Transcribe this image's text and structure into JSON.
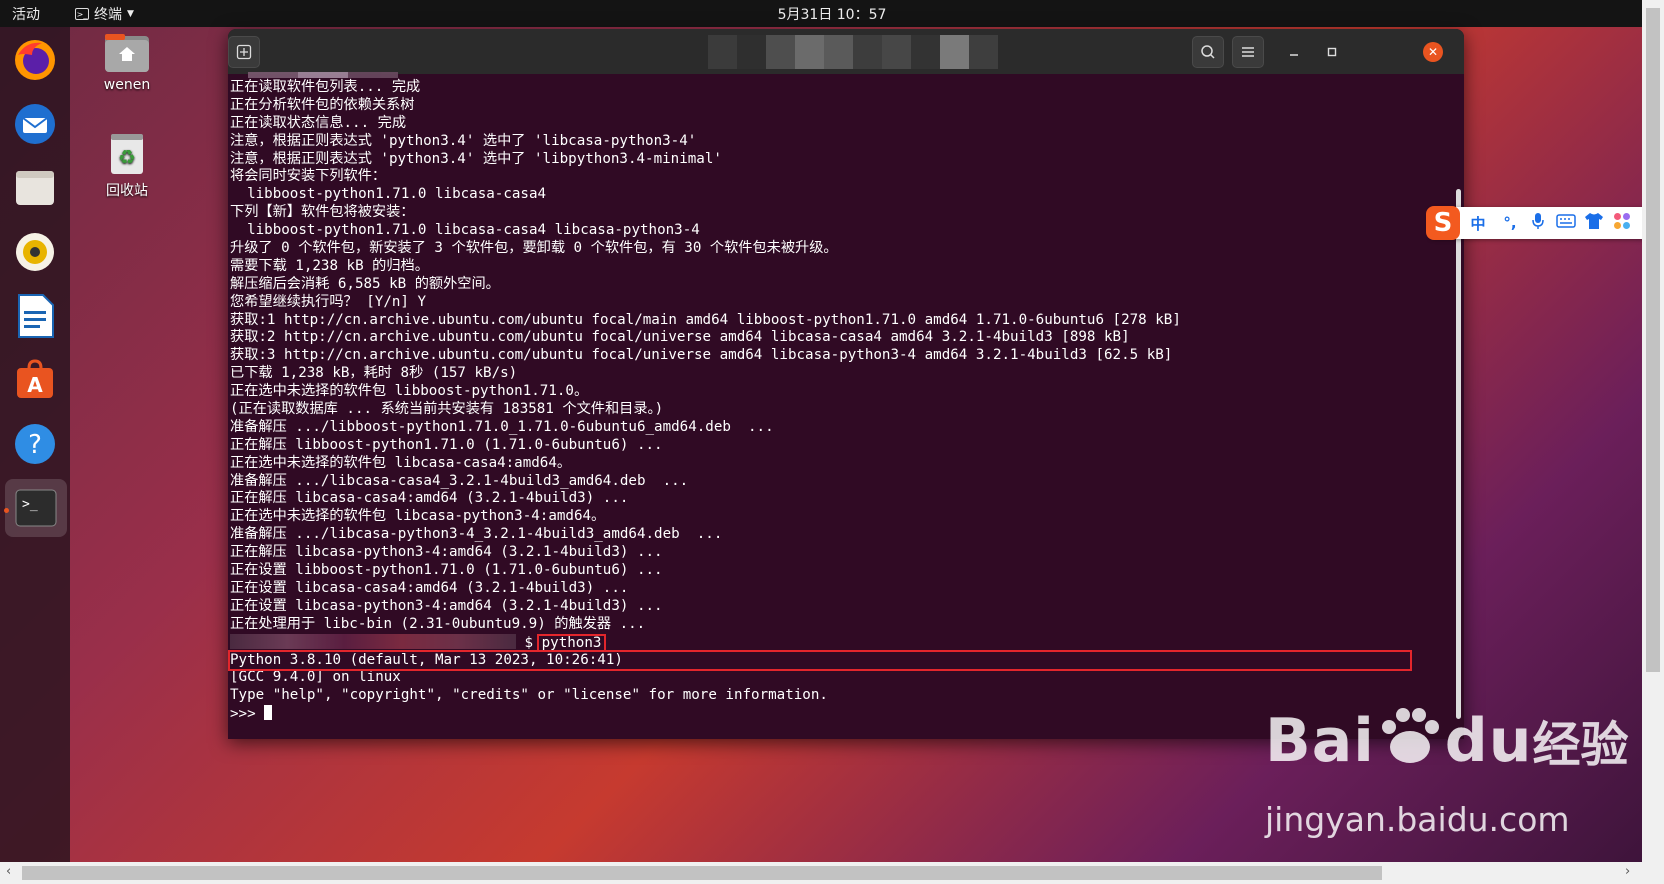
{
  "topbar": {
    "activities": "活动",
    "app_name": "终端",
    "clock": "5月31日  10：57"
  },
  "desktop": {
    "home_label": "wenen",
    "trash_label": "回收站"
  },
  "dock": {
    "items": [
      "firefox-icon",
      "thunderbird-icon",
      "files-icon",
      "rhythmbox-icon",
      "writer-icon",
      "software-icon",
      "help-icon",
      "terminal-icon"
    ]
  },
  "terminal": {
    "lines": [
      "正在读取软件包列表... 完成",
      "正在分析软件包的依赖关系树",
      "正在读取状态信息... 完成",
      "注意，根据正则表达式 'python3.4' 选中了 'libcasa-python3-4'",
      "注意，根据正则表达式 'python3.4' 选中了 'libpython3.4-minimal'",
      "将会同时安装下列软件：",
      "  libboost-python1.71.0 libcasa-casa4",
      "下列【新】软件包将被安装：",
      "  libboost-python1.71.0 libcasa-casa4 libcasa-python3-4",
      "升级了 0 个软件包，新安装了 3 个软件包，要卸载 0 个软件包，有 30 个软件包未被升级。",
      "需要下载 1,238 kB 的归档。",
      "解压缩后会消耗 6,585 kB 的额外空间。",
      "您希望继续执行吗？ [Y/n] Y",
      "获取:1 http://cn.archive.ubuntu.com/ubuntu focal/main amd64 libboost-python1.71.0 amd64 1.71.0-6ubuntu6 [278 kB]",
      "获取:2 http://cn.archive.ubuntu.com/ubuntu focal/universe amd64 libcasa-casa4 amd64 3.2.1-4build3 [898 kB]",
      "获取:3 http://cn.archive.ubuntu.com/ubuntu focal/universe amd64 libcasa-python3-4 amd64 3.2.1-4build3 [62.5 kB]",
      "已下载 1,238 kB，耗时 8秒 (157 kB/s)",
      "正在选中未选择的软件包 libboost-python1.71.0。",
      "(正在读取数据库 ... 系统当前共安装有 183581 个文件和目录。)",
      "准备解压 .../libboost-python1.71.0_1.71.0-6ubuntu6_amd64.deb  ...",
      "正在解压 libboost-python1.71.0 (1.71.0-6ubuntu6) ...",
      "正在选中未选择的软件包 libcasa-casa4:amd64。",
      "准备解压 .../libcasa-casa4_3.2.1-4build3_amd64.deb  ...",
      "正在解压 libcasa-casa4:amd64 (3.2.1-4build3) ...",
      "正在选中未选择的软件包 libcasa-python3-4:amd64。",
      "准备解压 .../libcasa-python3-4_3.2.1-4build3_amd64.deb  ...",
      "正在解压 libcasa-python3-4:amd64 (3.2.1-4build3) ...",
      "正在设置 libboost-python1.71.0 (1.71.0-6ubuntu6) ...",
      "正在设置 libcasa-casa4:amd64 (3.2.1-4build3) ...",
      "正在设置 libcasa-python3-4:amd64 (3.2.1-4build3) ...",
      "正在处理用于 libc-bin (2.31-0ubuntu9.9) 的触发器 ..."
    ],
    "prompt_symbol": "$",
    "command": "python3",
    "python_version": "Python 3.8.10 (default, Mar 13 2023, 10:26:41)",
    "gcc_line": "[GCC 9.4.0] on linux",
    "help_line": "Type \"help\", \"copyright\", \"credits\" or \"license\" for more information.",
    "repl_prompt": ">>> "
  },
  "ime": {
    "items": [
      "中",
      "°,",
      "mic-icon",
      "keyboard-icon",
      "shirt-icon",
      "apps-icon"
    ]
  },
  "watermark": {
    "brand": "Bai",
    "brand2": "du",
    "cn": "经验",
    "url": "jingyan.baidu.com"
  }
}
